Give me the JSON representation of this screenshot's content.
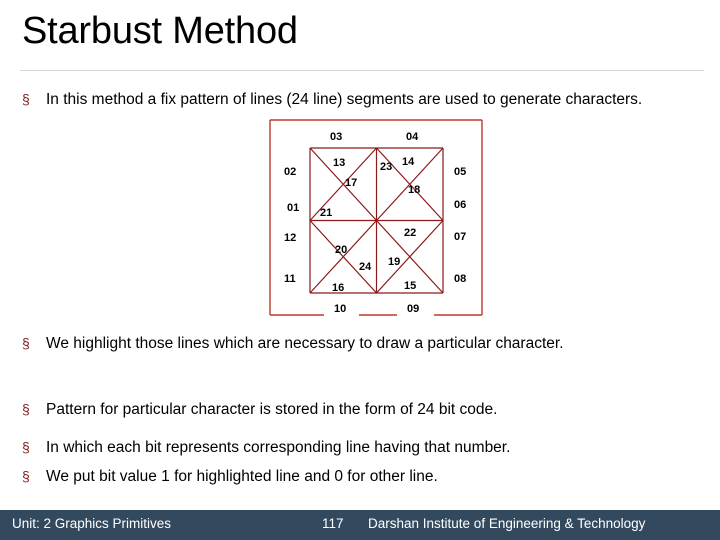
{
  "slide": {
    "title": "Starbust Method",
    "bullet_marker": "§"
  },
  "bullets": [
    {
      "id": "b1",
      "text": "In this method a fix pattern of lines (24 line) segments are used to generate characters."
    },
    {
      "id": "b2",
      "text": "We highlight those lines which are necessary to draw a particular character."
    },
    {
      "id": "b3",
      "text": "Pattern for particular character is stored in the form of 24 bit code."
    },
    {
      "id": "b4",
      "text": "In which each bit represents corresponding line having that number."
    },
    {
      "id": "b5",
      "text": "We put bit value 1 for highlighted line and 0 for other line."
    }
  ],
  "diagram": {
    "name": "starburst-24-segment-pattern",
    "line_color": "#8b1a1a",
    "outer_box_color": "#c0392b",
    "label_color": "#000000",
    "outer_labels": [
      {
        "id": "01",
        "text": "01"
      },
      {
        "id": "02",
        "text": "02"
      },
      {
        "id": "03",
        "text": "03"
      },
      {
        "id": "04",
        "text": "04"
      },
      {
        "id": "05",
        "text": "05"
      },
      {
        "id": "06",
        "text": "06"
      },
      {
        "id": "07",
        "text": "07"
      },
      {
        "id": "08",
        "text": "08"
      },
      {
        "id": "09",
        "text": "09"
      },
      {
        "id": "10",
        "text": "10"
      },
      {
        "id": "11",
        "text": "11"
      },
      {
        "id": "12",
        "text": "12"
      }
    ],
    "inner_labels": [
      {
        "id": "13",
        "text": "13"
      },
      {
        "id": "14",
        "text": "14"
      },
      {
        "id": "15",
        "text": "15"
      },
      {
        "id": "16",
        "text": "16"
      },
      {
        "id": "17",
        "text": "17"
      },
      {
        "id": "18",
        "text": "18"
      },
      {
        "id": "19",
        "text": "19"
      },
      {
        "id": "20",
        "text": "20"
      },
      {
        "id": "21",
        "text": "21"
      },
      {
        "id": "22",
        "text": "22"
      },
      {
        "id": "23",
        "text": "23"
      },
      {
        "id": "24",
        "text": "24"
      }
    ]
  },
  "footer": {
    "unit": "Unit: 2 Graphics Primitives",
    "page_number": "117",
    "institute": "Darshan Institute of Engineering & Technology",
    "background": "#334a5e"
  }
}
